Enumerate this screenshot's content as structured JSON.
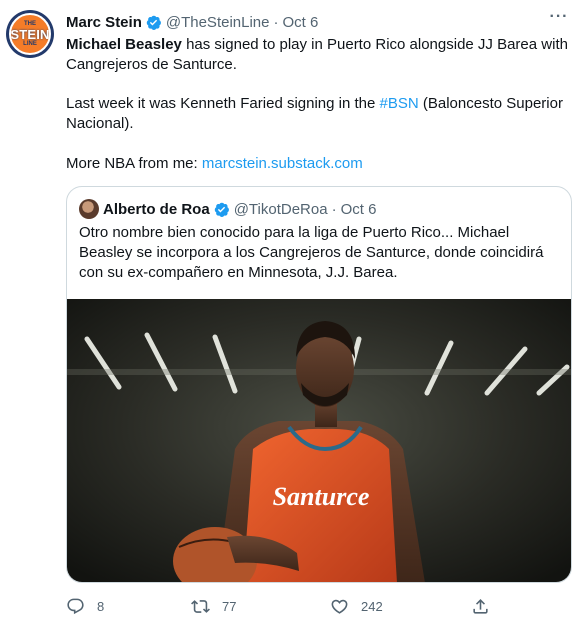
{
  "tweet": {
    "author_name": "Marc Stein",
    "handle": "@TheSteinLine",
    "separator": "·",
    "date": "Oct 6",
    "avatar_text": {
      "top": "THE",
      "middle": "STEIN",
      "bottom": "LINE"
    },
    "line1_bold": "Michael Beasley",
    "line1_rest": " has signed to play in Puerto Rico alongside JJ Barea with",
    "line2": "Cangrejeros de Santurce.",
    "para2_pre": "Last week it was Kenneth Faried signing in the ",
    "para2_hashtag": "#BSN",
    "para2_post": " (Baloncesto Superior",
    "para2_line2": "Nacional).",
    "para3_pre": "More NBA from me: ",
    "para3_link": "marcstein.substack.com"
  },
  "quote": {
    "author_name": "Alberto de Roa",
    "handle": "@TikotDeRoa",
    "separator": "·",
    "date": "Oct 6",
    "line1": "Otro nombre bien conocido para la liga de Puerto Rico... Michael",
    "line2": "Beasley se incorpora a los Cangrejeros de Santurce, donde coincidirá",
    "line3": "con su ex-compañero en Minnesota, J.J. Barea.",
    "media_jersey_text": "Santurce"
  },
  "actions": {
    "reply_icon": "reply-icon",
    "reply_count": "8",
    "retweet_icon": "retweet-icon",
    "retweet_count": "77",
    "like_icon": "heart-icon",
    "like_count": "242",
    "share_icon": "share-icon"
  },
  "colors": {
    "link": "#1d9bf0",
    "muted": "#536471",
    "jersey": "#e8542a"
  }
}
